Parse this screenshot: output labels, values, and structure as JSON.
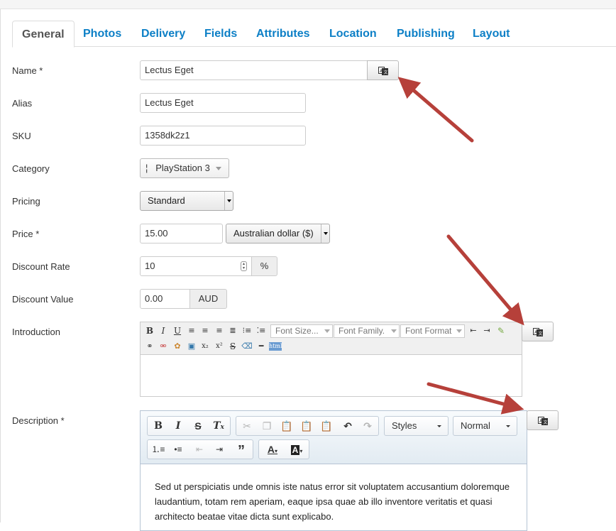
{
  "tabs": [
    "General",
    "Photos",
    "Delivery",
    "Fields",
    "Attributes",
    "Location",
    "Publishing",
    "Layout"
  ],
  "fields": {
    "name_label": "Name *",
    "name_value": "Lectus Eget",
    "alias_label": "Alias",
    "alias_value": "Lectus Eget",
    "sku_label": "SKU",
    "sku_value": "1358dk2z1",
    "category_label": "Category",
    "category_value": "¦   PlayStation 3",
    "pricing_label": "Pricing",
    "pricing_value": "Standard",
    "price_label": "Price *",
    "price_value": "15.00",
    "currency_value": "Australian dollar ($)",
    "discount_rate_label": "Discount Rate",
    "discount_rate_value": "10",
    "discount_rate_unit": "%",
    "discount_value_label": "Discount Value",
    "discount_value_value": "0.00",
    "discount_value_unit": "AUD",
    "introduction_label": "Introduction",
    "description_label": "Description *"
  },
  "intro_editor": {
    "font_size": "Font Size...",
    "font_family": "Font Family.",
    "font_format": "Font Format"
  },
  "desc_editor": {
    "styles": "Styles",
    "format": "Normal",
    "content": "Sed ut perspiciatis unde omnis iste natus error sit voluptatem accusantium doloremque laudantium, totam rem aperiam, eaque ipsa quae ab illo inventore veritatis et quasi architecto beatae vitae dicta sunt explicabo."
  },
  "colors": {
    "tab_link": "#0c7fc6",
    "arrow": "#b6403a"
  }
}
